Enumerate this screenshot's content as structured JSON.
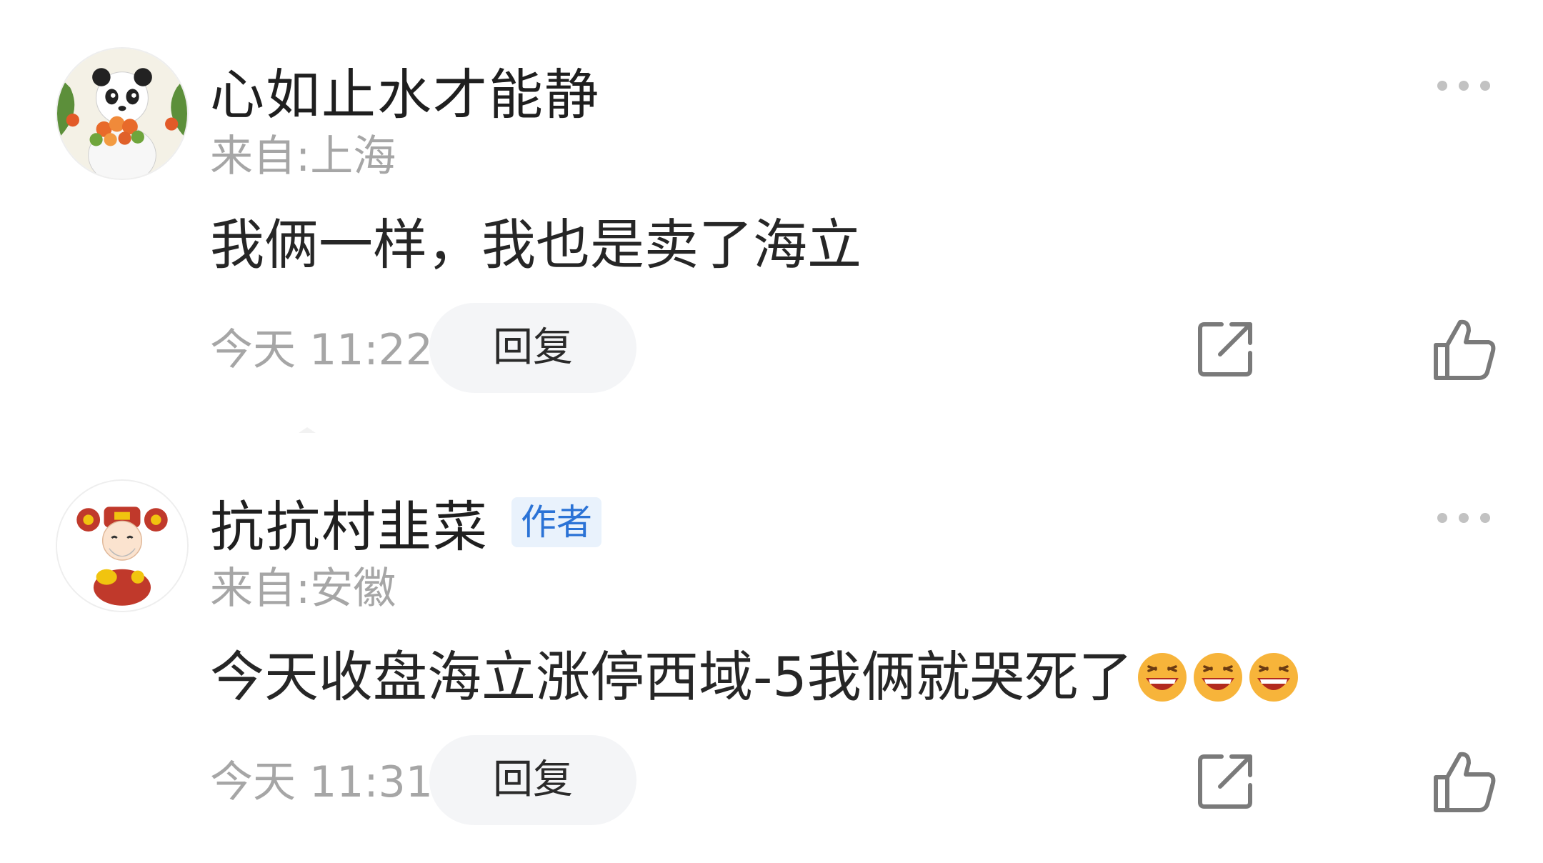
{
  "comments": [
    {
      "username": "心如止水才能静",
      "avatar_icon": "panda-avatar-icon",
      "badge": "",
      "location": "来自:上海",
      "content": "我俩一样，我也是卖了海立",
      "emojis": [],
      "time": "今天 11:22",
      "reply_label": "回复"
    },
    {
      "username": "抗抗村韭菜",
      "avatar_icon": "god-of-wealth-avatar-icon",
      "badge": "作者",
      "location": "来自:安徽",
      "content": "今天收盘海立涨停西域-5我俩就哭死了",
      "emojis": [
        "laughing-face-emoji",
        "laughing-face-emoji",
        "laughing-face-emoji"
      ],
      "time": "今天 11:31",
      "reply_label": "回复"
    }
  ],
  "colors": {
    "badge_text": "#2b73d6",
    "badge_bg": "#e9f2fc",
    "meta_text": "#a6a6a6",
    "reply_bg": "#f4f5f7",
    "icon_stroke": "#7a7a7a"
  }
}
